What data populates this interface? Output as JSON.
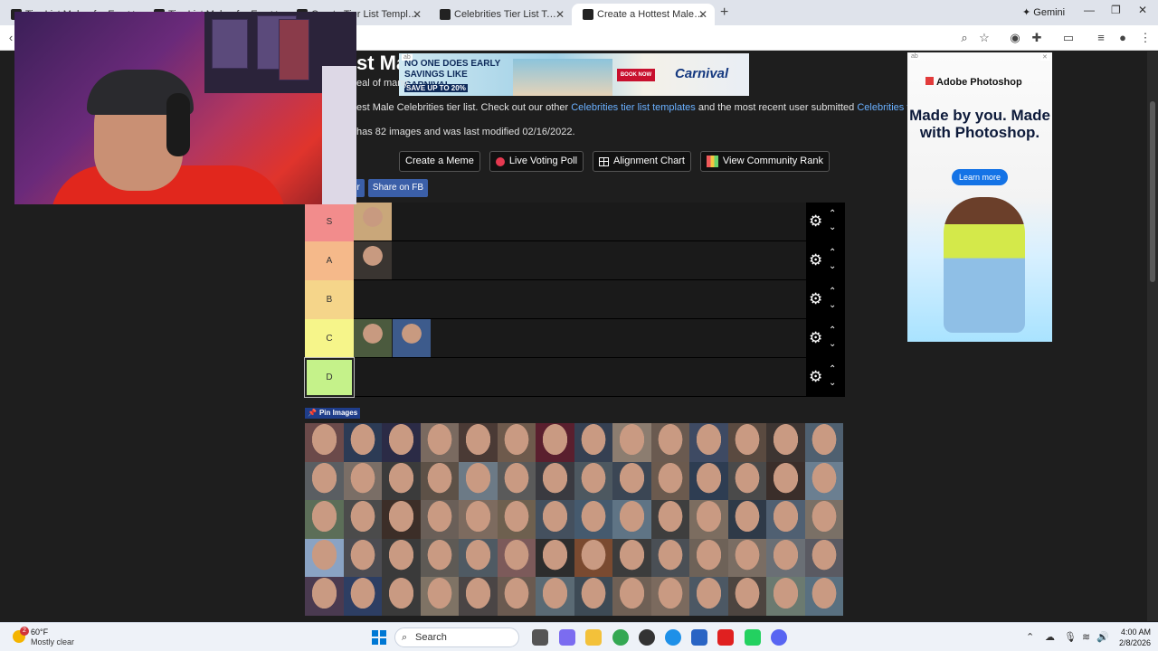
{
  "browser": {
    "tabs": [
      {
        "label": "Tier List Maker for Everything",
        "active": false
      },
      {
        "label": "Tier List Maker for Everything",
        "active": false
      },
      {
        "label": "Create Tier List Templates by C",
        "active": false
      },
      {
        "label": "Celebrities Tier List Templates",
        "active": false
      },
      {
        "label": "Create a Hottest Male Celebrit",
        "active": true
      }
    ],
    "new_tab": "+",
    "gemini_label": "✦ Gemini",
    "window_controls": [
      "—",
      "❐",
      "✕"
    ]
  },
  "page": {
    "title_fragment": "st Ma",
    "intro_fragment": "eal of many",
    "description": {
      "prefix": "est Male Celebrities tier list. Check out our other ",
      "link1": "Celebrities tier list templates",
      "middle": " and the most recent user submitted ",
      "link2": "Celebrities tier lists",
      "suffix": "."
    },
    "meta": "has 82 images and was last modified 02/16/2022.",
    "buttons": {
      "create_meme": "Create a Meme",
      "live_poll": "Live Voting Poll",
      "alignment": "Alignment Chart",
      "community_rank": "View Community Rank"
    },
    "share": {
      "twitter_fragment": "er",
      "facebook": "Share on FB"
    },
    "pin_images": "Pin Images"
  },
  "tiers": [
    {
      "label": "S",
      "color": "#f28c8c",
      "items": [
        "#c9a77a"
      ]
    },
    {
      "label": "A",
      "color": "#f5b98a",
      "items": [
        "#3a3531"
      ]
    },
    {
      "label": "B",
      "color": "#f5d58a",
      "items": []
    },
    {
      "label": "C",
      "color": "#f6f58a",
      "items": [
        "#4b5a3e",
        "#3d5b8c"
      ]
    },
    {
      "label": "D",
      "color": "#c5f28a",
      "items": []
    }
  ],
  "pool_colors": [
    "#6b4a4a",
    "#2c3b55",
    "#2b2b46",
    "#7a6a60",
    "#4a3a35",
    "#6e5a4c",
    "#5a1f2e",
    "#354052",
    "#8c7d70",
    "#6a5a50",
    "#3e4a63",
    "#5a4a40",
    "#3d3532",
    "#4f6070",
    "#5a5e62",
    "#7a6e66",
    "#3b3b3b",
    "#5d5147",
    "#6c7a86",
    "#5a5a5a",
    "#3a3a40",
    "#4d5860",
    "#3b4654",
    "#6b5a4e",
    "#2e3d52",
    "#4a4a4a",
    "#3a2e2a",
    "#6b7f91",
    "#5c6e58",
    "#4b4b4b",
    "#3c2e28",
    "#6a5f58",
    "#7d6b5f",
    "#6e604f",
    "#44505e",
    "#455a6e",
    "#5f7485",
    "#3e3e3e",
    "#7c6d60",
    "#2f3a48",
    "#506072",
    "#7a7066",
    "#8aa3c4",
    "#4c4c52",
    "#3a3a3a",
    "#5e5a55",
    "#4f5a63",
    "#7c5a5a",
    "#2d2d2d",
    "#7a4a30",
    "#3c3c3c",
    "#4a4f55",
    "#6e6258",
    "#7a6d63",
    "#6a6f75",
    "#5a5a62",
    "#4a3a50",
    "#2d3e63",
    "#3a3a3a",
    "#7f7365",
    "#4a4545",
    "#6a5a50",
    "#5a6a74",
    "#3d4a55",
    "#6f6055",
    "#7b6a5e",
    "#4c5864",
    "#4d4540",
    "#6b7a70",
    "#597080"
  ],
  "ad_banner": {
    "headline": "NO ONE DOES EARLY SAVINGS LIKE CARNIVAL",
    "sub": "SAVE UP TO 20%",
    "cta": "BOOK NOW",
    "brand": "Carnival"
  },
  "side_ad": {
    "logo": "Adobe Photoshop",
    "headline": "Made by you. Made with Photoshop.",
    "cta": "Learn more"
  },
  "taskbar": {
    "badge": "2",
    "temperature": "60°F",
    "condition": "Mostly clear",
    "search_label": "Search",
    "time": "4:00 AM",
    "date": "2/8/2026"
  }
}
